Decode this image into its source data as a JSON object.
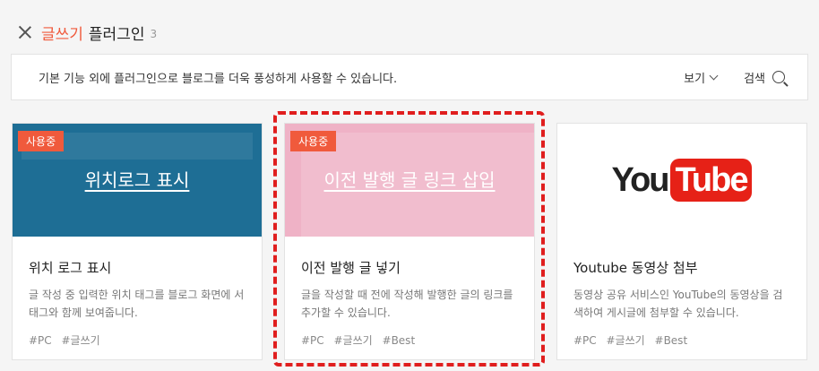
{
  "header": {
    "accent": "글쓰기",
    "title": "플러그인",
    "count": "3"
  },
  "info_bar": {
    "text": "기본 기능 외에 플러그인으로 블로그를 더욱 풍성하게 사용할 수 있습니다.",
    "view_label": "보기",
    "search_label": "검색"
  },
  "cards": [
    {
      "badge": "사용중",
      "thumb_text": "위치로그 표시",
      "title": "위치 로그 표시",
      "description": "글 작성 중 입력한 위치 태그를 블로그 화면에 서 태그와 함께 보여줍니다.",
      "tags": [
        "#PC",
        "#글쓰기"
      ]
    },
    {
      "badge": "사용중",
      "thumb_text": "이전 발행 글 링크 삽입",
      "title": "이전 발행 글 넣기",
      "description": "글을 작성할 때 전에 작성해 발행한 글의 링크를 추가할 수 있습니다.",
      "tags": [
        "#PC",
        "#글쓰기",
        "#Best"
      ]
    },
    {
      "logo_you": "You",
      "logo_tube": "Tube",
      "title": "Youtube 동영상 첨부",
      "description": "동영상 공유 서비스인 YouTube의 동영상을 검색하여 게시글에 첨부할 수 있습니다.",
      "tags": [
        "#PC",
        "#글쓰기",
        "#Best"
      ]
    }
  ],
  "colors": {
    "accent": "#f05a3c",
    "highlight": "#e01e1e",
    "youtube_red": "#e62117"
  }
}
